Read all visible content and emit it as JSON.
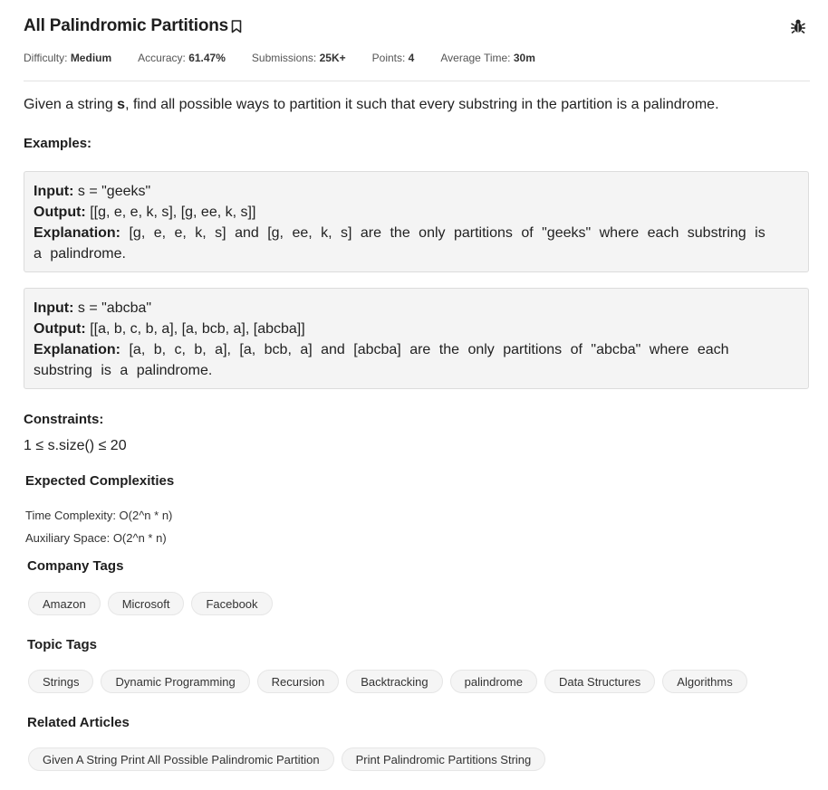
{
  "problem": {
    "title": "All Palindromic Partitions",
    "meta": [
      {
        "label": "Difficulty:",
        "value": "Medium"
      },
      {
        "label": "Accuracy:",
        "value": "61.47%"
      },
      {
        "label": "Submissions:",
        "value": "25K+"
      },
      {
        "label": "Points:",
        "value": "4"
      },
      {
        "label": "Average Time:",
        "value": "30m"
      }
    ],
    "description_pre": "Given a string ",
    "description_var": "s",
    "description_post": ", find all possible ways to partition it such that every substring in the partition is a palindrome."
  },
  "examples_heading": "Examples:",
  "examples": [
    {
      "input_label": "Input:",
      "input": "s = \"geeks\"",
      "output_label": "Output:",
      "output": "[[g, e, e, k, s], [g, ee, k, s]]",
      "explanation_label": "Explanation:",
      "explanation_line1": "[g, e, e, k, s] and [g, ee, k, s] are the only partitions of \"geeks\" where each substring is",
      "explanation_line2": "a palindrome."
    },
    {
      "input_label": "Input:",
      "input": "s = \"abcba\"",
      "output_label": "Output:",
      "output": "[[a, b, c, b, a], [a, bcb, a], [abcba]]",
      "explanation_label": "Explanation:",
      "explanation_line1": "[a, b, c, b, a], [a, bcb, a] and [abcba] are the only partitions of \"abcba\" where each",
      "explanation_line2": "substring is a palindrome."
    }
  ],
  "constraints": {
    "heading": "Constraints:",
    "text": "1 ≤ s.size() ≤ 20"
  },
  "complexities": {
    "heading": "Expected Complexities",
    "time": "Time Complexity: O(2^n * n)",
    "space": "Auxiliary Space: O(2^n * n)"
  },
  "company_tags": {
    "heading": "Company Tags",
    "items": [
      "Amazon",
      "Microsoft",
      "Facebook"
    ]
  },
  "topic_tags": {
    "heading": "Topic Tags",
    "items": [
      "Strings",
      "Dynamic Programming",
      "Recursion",
      "Backtracking",
      "palindrome",
      "Data Structures",
      "Algorithms"
    ]
  },
  "related_articles": {
    "heading": "Related Articles",
    "items": [
      "Given A String Print All Possible Palindromic Partition",
      "Print Palindromic Partitions String"
    ]
  },
  "icons": {
    "bookmark": "bookmark-icon",
    "report": "bug-icon"
  }
}
